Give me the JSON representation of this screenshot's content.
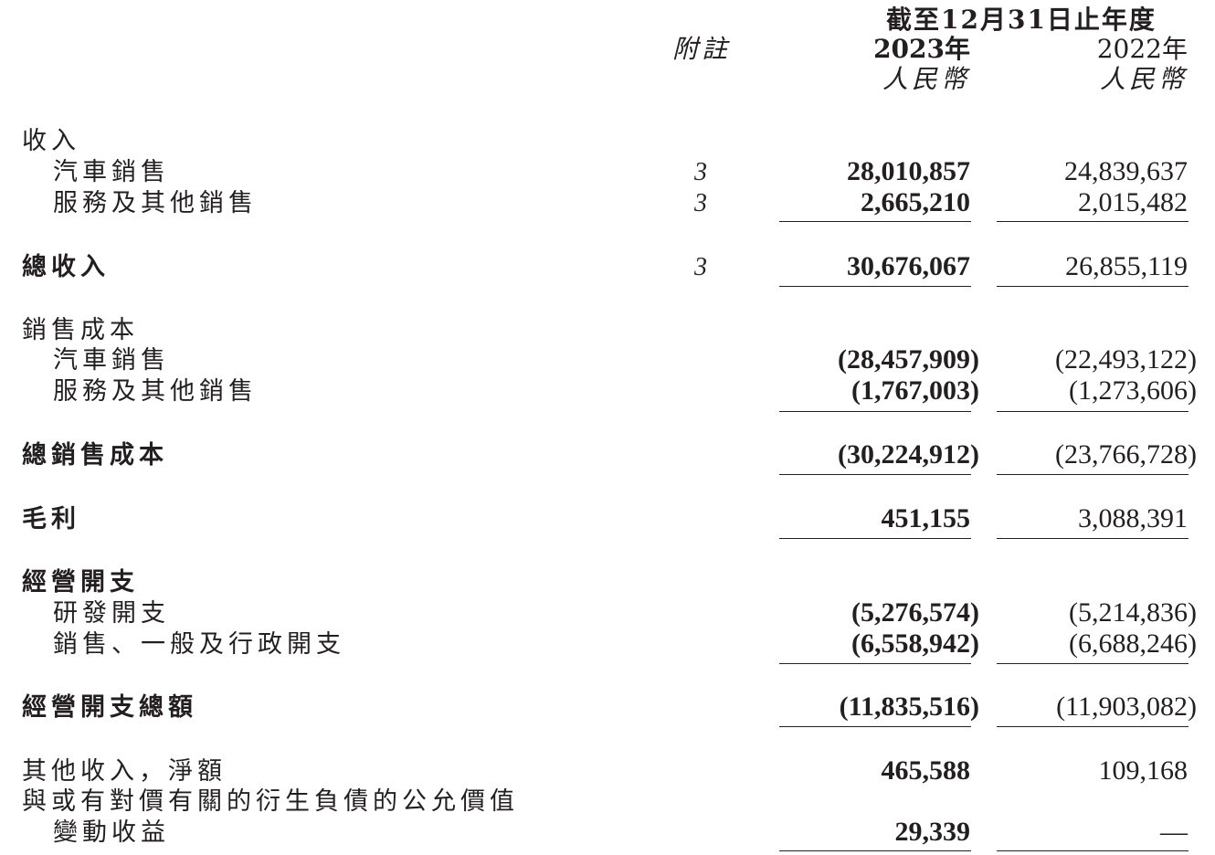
{
  "header": {
    "period": "截至12月31日止年度",
    "note_col": "附註",
    "year_current": "2023年",
    "year_prior": "2022年",
    "currency_current": "人民幣",
    "currency_prior": "人民幣"
  },
  "rows": {
    "revenue": {
      "label": "收入"
    },
    "rev_auto": {
      "label": "汽車銷售",
      "note": "3",
      "y2023": "28,010,857",
      "y2022": "24,839,637"
    },
    "rev_services": {
      "label": "服務及其他銷售",
      "note": "3",
      "y2023": "2,665,210",
      "y2022": "2,015,482"
    },
    "total_revenue": {
      "label": "總收入",
      "note": "3",
      "y2023": "30,676,067",
      "y2022": "26,855,119"
    },
    "cost_of_sales": {
      "label": "銷售成本"
    },
    "cos_auto": {
      "label": "汽車銷售",
      "y2023": "(28,457,909)",
      "y2022": "(22,493,122)"
    },
    "cos_services": {
      "label": "服務及其他銷售",
      "y2023": "(1,767,003)",
      "y2022": "(1,273,606)"
    },
    "total_cos": {
      "label": "總銷售成本",
      "y2023": "(30,224,912)",
      "y2022": "(23,766,728)"
    },
    "gross_profit": {
      "label": "毛利",
      "y2023": "451,155",
      "y2022": "3,088,391"
    },
    "opex": {
      "label": "經營開支"
    },
    "rnd": {
      "label": "研發開支",
      "y2023": "(5,276,574)",
      "y2022": "(5,214,836)"
    },
    "sga": {
      "label": "銷售、一般及行政開支",
      "y2023": "(6,558,942)",
      "y2022": "(6,688,246)"
    },
    "total_opex": {
      "label": "經營開支總額",
      "y2023": "(11,835,516)",
      "y2022": "(11,903,082)"
    },
    "other_income": {
      "label": "其他收入，淨額",
      "y2023": "465,588",
      "y2022": "109,168"
    },
    "fv_gain": {
      "label_line1": "與或有對價有關的衍生負債的公允價值",
      "label_line2": "變動收益",
      "y2023": "29,339",
      "y2022": "—"
    }
  }
}
